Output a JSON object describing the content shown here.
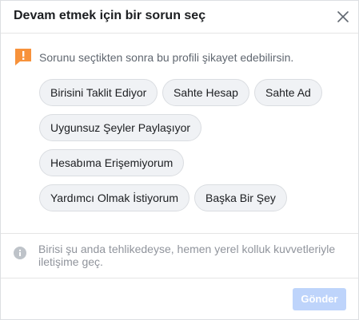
{
  "dialog": {
    "title": "Devam etmek için bir sorun seç",
    "close_icon": "close-icon"
  },
  "notice": {
    "icon": "exclamation-flag-icon",
    "text": "Sorunu seçtikten sonra bu profili şikayet edebilirsin."
  },
  "options": [
    "Birisini Taklit Ediyor",
    "Sahte Hesap",
    "Sahte Ad",
    "Uygunsuz Şeyler Paylaşıyor",
    "Hesabıma Erişemiyorum",
    "Yardımcı Olmak İstiyorum",
    "Başka Bir Şey"
  ],
  "info": {
    "icon": "info-icon",
    "text": "Birisi şu anda tehlikedeyse, hemen yerel kolluk kuvvetleriyle iletişime geç."
  },
  "footer": {
    "send_label": "Gönder",
    "send_enabled": false
  },
  "colors": {
    "accent_orange": "#f7923b",
    "button_disabled": "#bed4fb",
    "chip_bg": "#f0f2f5",
    "muted_text": "#90949c"
  }
}
